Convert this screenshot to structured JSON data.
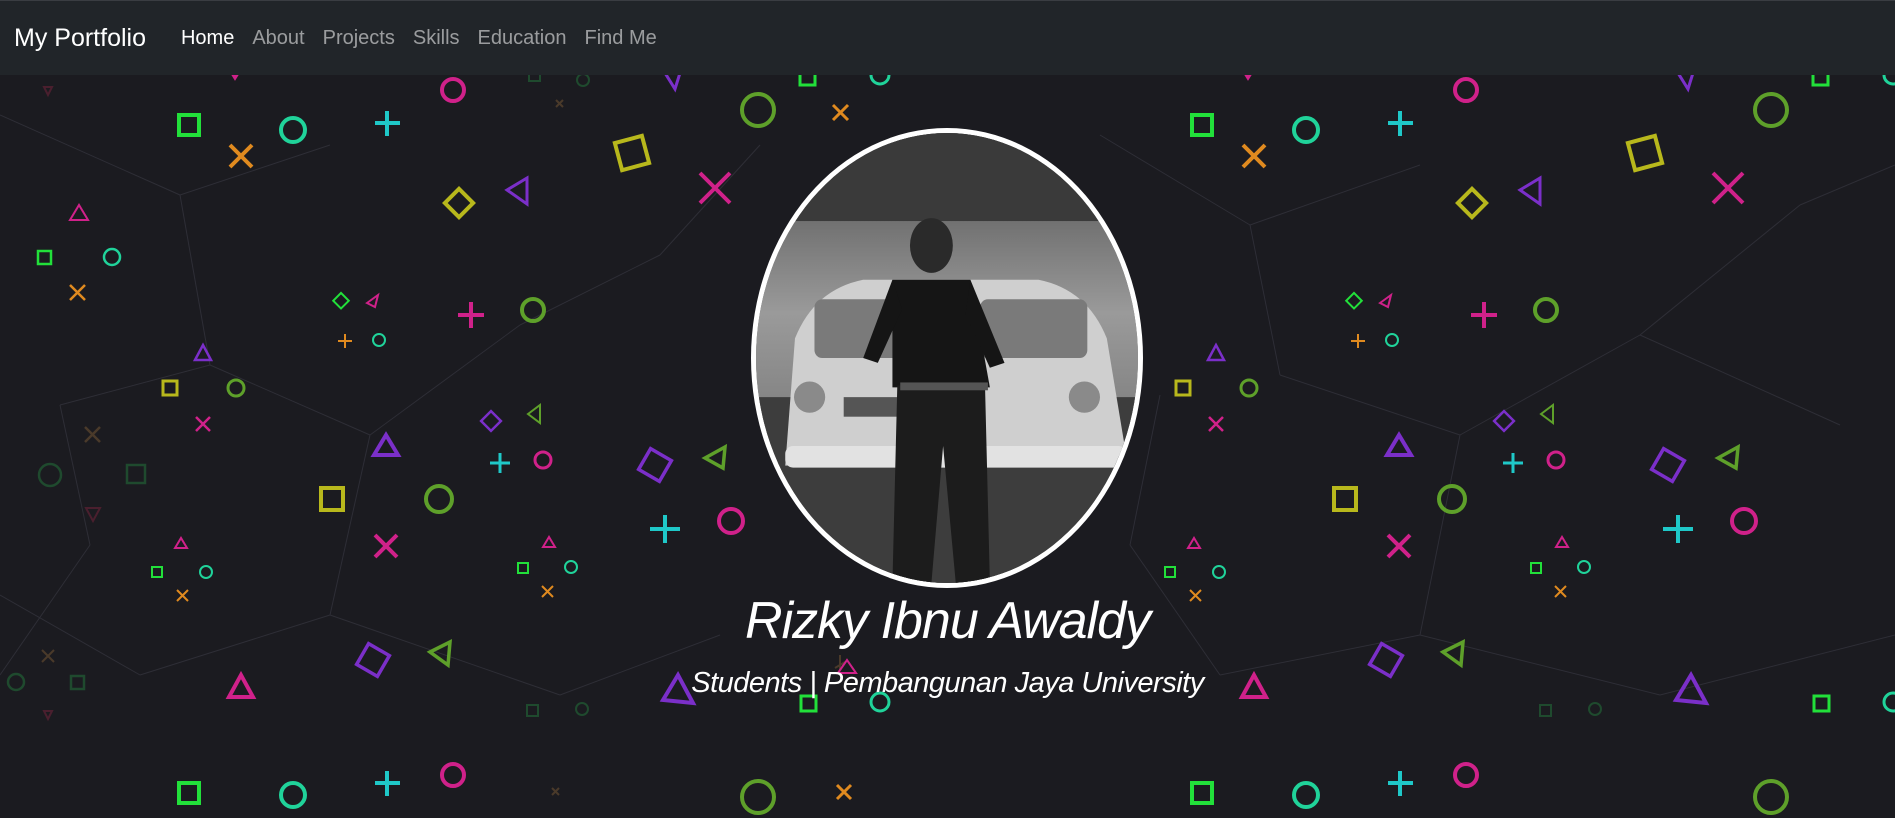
{
  "navbar": {
    "brand": "My Portfolio",
    "links": [
      {
        "label": "Home",
        "active": true
      },
      {
        "label": "About",
        "active": false
      },
      {
        "label": "Projects",
        "active": false
      },
      {
        "label": "Skills",
        "active": false
      },
      {
        "label": "Education",
        "active": false
      },
      {
        "label": "Find Me",
        "active": false
      }
    ]
  },
  "hero": {
    "name": "Rizky Ibnu Awaldy",
    "subtitle": "Students | Pembangunan Jaya University"
  },
  "colors": {
    "navbar_bg": "#212529",
    "hero_bg": "#1b1b20",
    "shape_green": "#22e03a",
    "shape_teal": "#20d39a",
    "shape_cyan": "#1fc8c8",
    "shape_magenta": "#d0218a",
    "shape_orange": "#e08a1f",
    "shape_olive": "#b8b81c",
    "shape_purple": "#7b2fc9"
  }
}
